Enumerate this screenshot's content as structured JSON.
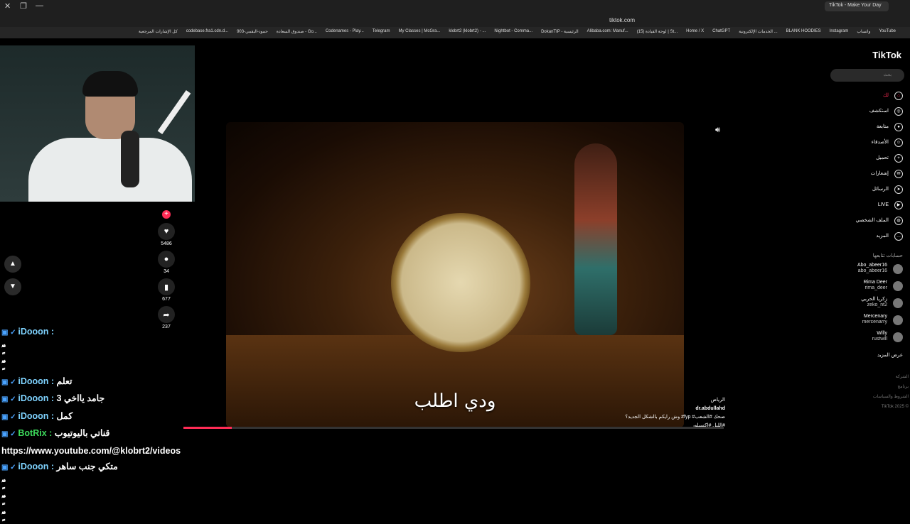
{
  "browser": {
    "tab_title": "TikTok - Make Your Day",
    "url": "tiktok.com",
    "bookmarks": [
      "YouTube",
      "واتساب",
      "Instagram",
      "BLANK HOODIES",
      "الخدمات الإلكترونية ...",
      "ChatGPT",
      "Home / X",
      "(15) لوحة القيادة | St...",
      "Alibaba.com: Manuf...",
      "DokanTIP - الرئيسية",
      "Nightbot - Comma...",
      "klobrt2 (klobrt2) - ...",
      "My Classes | McGra...",
      "Telegram",
      "Codenames - Play...",
      "صندوق السعادة - Go...",
      "903-حمود-البقمي",
      "codebase.fra1.cdn.d...",
      "كل الإشارات المرجعية"
    ]
  },
  "video": {
    "subtitle": "ودي اطلب",
    "author": "dr.abdullahd",
    "tag": "الرياض",
    "caption": "وش رايكم بالشكل الجديد؟ #fyp #ضحك #الشعب #الليل #اكسبلور",
    "progress": 0.09
  },
  "actions": {
    "likes": "5486",
    "comments": "34",
    "saves": "677",
    "shares": "237"
  },
  "chat": [
    {
      "user": "iDooon",
      "text": ""
    },
    {
      "user": "",
      "text": "ٍّٓٓٓٓٓٓٓٓٓٓٓٓٓٓٓٓٓٓٓٓٓٓٓٓٓٓٓٓٓٓٓٓٓٓٓٓ"
    },
    {
      "user": "",
      "text": "ٍّٓٓٓٓٓٓٓٓٓٓٓٓٓٓٓٓٓٓٓٓٓٓٓٓٓٓٓٓٓٓٓٓٓٓٓٓ"
    },
    {
      "user": "iDooon",
      "text": "تعلم"
    },
    {
      "user": "iDooon",
      "text": "جامد يااخي 3"
    },
    {
      "user": "iDooon",
      "text": "كمل"
    },
    {
      "user": "BotRix",
      "text": "قناتي باليوتيوب",
      "bot": true
    },
    {
      "user": "",
      "text": "https://www.youtube.com/@klobrt2/videos"
    },
    {
      "user": "iDooon",
      "text": "متكي جنب ساهر"
    },
    {
      "user": "",
      "text": "ٍّٓٓٓٓٓٓٓٓٓٓٓٓٓٓٓٓٓٓٓٓٓٓٓٓٓٓٓٓٓٓٓٓٓٓٓٓ"
    },
    {
      "user": "",
      "text": "ٍّٓٓٓٓٓٓٓٓٓٓٓٓٓٓٓٓٓٓٓٓٓٓٓٓٓٓٓٓٓٓٓٓٓٓٓٓ"
    },
    {
      "user": "",
      "text": "ٍّٓٓٓٓٓٓٓٓٓٓٓٓٓٓٓٓٓٓٓٓٓٓٓٓٓٓٓٓٓٓٓٓٓٓٓٓ"
    }
  ],
  "sidebar": {
    "logo": "TikTok",
    "search_placeholder": "بحث",
    "nav": [
      {
        "label": "لك",
        "icon": "home-icon"
      },
      {
        "label": "استكشف",
        "icon": "compass-icon"
      },
      {
        "label": "متابعة",
        "icon": "avatar-icon"
      },
      {
        "label": "الأصدقاء",
        "icon": "friends-icon"
      },
      {
        "label": "تحميل",
        "icon": "upload-icon"
      },
      {
        "label": "إشعارات",
        "icon": "inbox-icon"
      },
      {
        "label": "الرسائل",
        "icon": "send-icon"
      },
      {
        "label": "LIVE",
        "icon": "live-icon"
      },
      {
        "label": "الملف الشخصي",
        "icon": "profile-icon"
      },
      {
        "label": "المزيد",
        "icon": "more-icon"
      }
    ],
    "following_header": "حسابات تتابعها",
    "following": [
      {
        "name": "Abo_abeer16",
        "user": "abo_abeer16"
      },
      {
        "name": "Rima Deer",
        "user": "rima_deer"
      },
      {
        "name": "زكريا الحربي",
        "user": "zeko_nt2"
      },
      {
        "name": "Mercenary",
        "user": "mercenarry"
      },
      {
        "name": "Willy",
        "user": "rustwill"
      }
    ],
    "show_more": "عرض المزيد",
    "footer": [
      "الشركة",
      "برنامج",
      "الشروط والسياسات",
      "TikTok 2025 ©"
    ]
  }
}
